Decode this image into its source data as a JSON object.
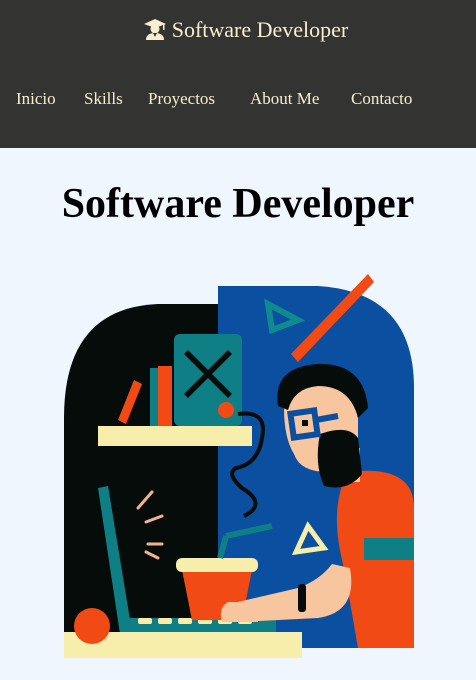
{
  "header": {
    "brand_icon": "graduate-student-icon",
    "brand_text": "Software Developer",
    "nav": [
      "Inicio",
      "Skills",
      "Proyectos",
      "About Me",
      "Contacto"
    ]
  },
  "main": {
    "title": "Software Developer",
    "hero_image": "developer-at-laptop-illustration"
  },
  "colors": {
    "header_bg": "#333331",
    "header_text": "#f8efd0",
    "page_bg": "#eff6fd",
    "illustration_blue": "#0a4fa0",
    "illustration_orange": "#f24a14",
    "illustration_teal": "#0f7f86",
    "illustration_cream": "#f7eeab"
  }
}
